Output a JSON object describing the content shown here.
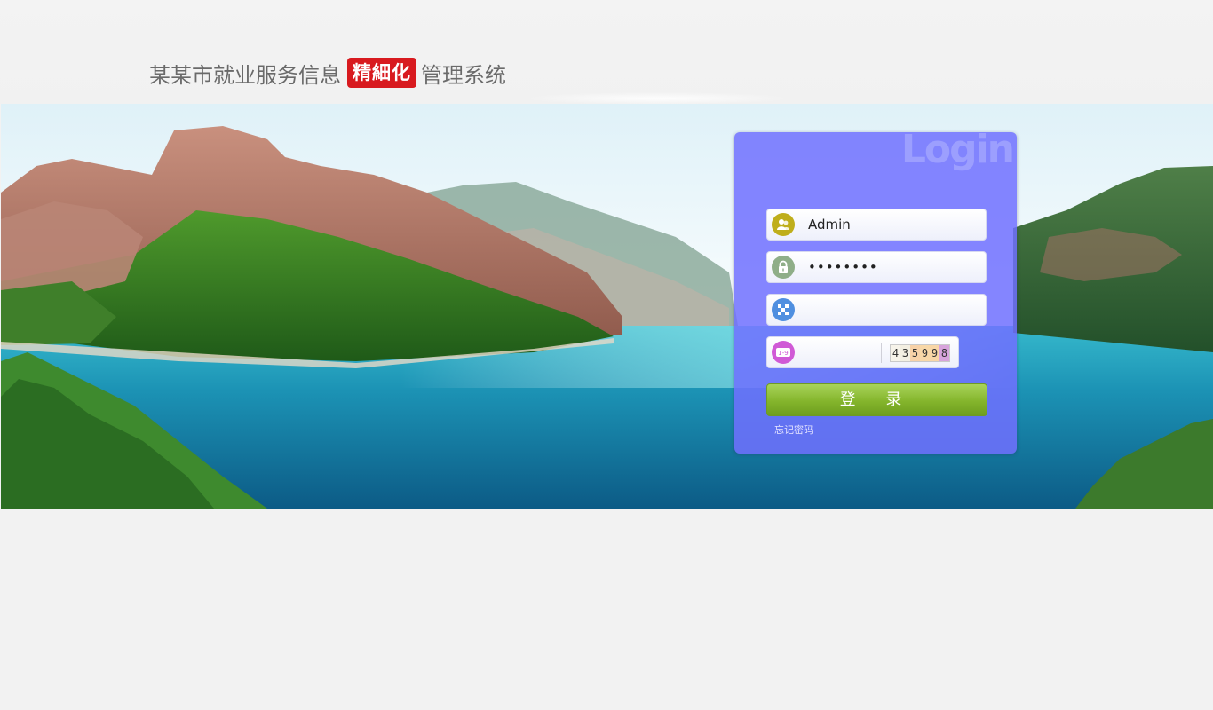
{
  "header": {
    "title_prefix": "某某市就业服务信息",
    "title_badge": "精細化",
    "title_suffix": "管理系统"
  },
  "login": {
    "watermark": "Login",
    "username_value": "Admin",
    "password_value": "••••••••",
    "code_field_value": "",
    "captcha_field_value": "",
    "captcha_chars": [
      "4",
      "3",
      "5",
      "9",
      "9",
      "8"
    ],
    "submit_label": "登 录",
    "forgot_label": "忘记密码"
  },
  "icons": {
    "username": "user-icon",
    "password": "lock-icon",
    "code": "grid-code-icon",
    "captcha": "number-icon"
  },
  "colors": {
    "badge": "#d81a1f",
    "panel": "#7070ff",
    "button": "#84b52c"
  }
}
